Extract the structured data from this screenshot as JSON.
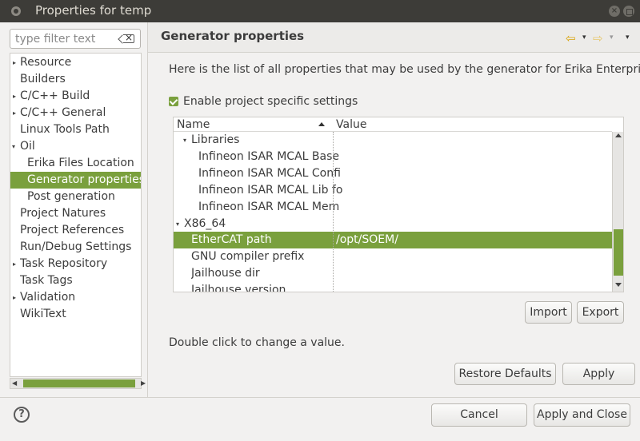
{
  "window": {
    "title": "Properties for temp",
    "close_glyph": "×"
  },
  "filter": {
    "placeholder": "type filter text"
  },
  "tree": {
    "items": [
      {
        "label": "Resource",
        "expander": "▸",
        "selected": false
      },
      {
        "label": "Builders",
        "expander": "",
        "selected": false
      },
      {
        "label": "C/C++ Build",
        "expander": "▸",
        "selected": false
      },
      {
        "label": "C/C++ General",
        "expander": "▸",
        "selected": false
      },
      {
        "label": "Linux Tools Path",
        "expander": "",
        "selected": false
      },
      {
        "label": "Oil",
        "expander": "▾",
        "selected": false
      },
      {
        "label": "Erika Files Location",
        "expander": "",
        "selected": false
      },
      {
        "label": "Generator properties",
        "expander": "",
        "selected": true
      },
      {
        "label": "Post generation",
        "expander": "",
        "selected": false
      },
      {
        "label": "Project Natures",
        "expander": "",
        "selected": false
      },
      {
        "label": "Project References",
        "expander": "",
        "selected": false
      },
      {
        "label": "Run/Debug Settings",
        "expander": "",
        "selected": false
      },
      {
        "label": "Task Repository",
        "expander": "▸",
        "selected": false
      },
      {
        "label": "Task Tags",
        "expander": "",
        "selected": false
      },
      {
        "label": "Validation",
        "expander": "▸",
        "selected": false
      },
      {
        "label": "WikiText",
        "expander": "",
        "selected": false
      }
    ]
  },
  "page": {
    "title": "Generator properties",
    "description": "Here is the list of all properties that may be used by the generator for Erika Enterprise.",
    "enable_label": "Enable project specific settings",
    "enable_checked": true,
    "hint": "Double click to change a value.",
    "nav": {
      "back": "⇦",
      "forward": "⇨",
      "dropdown": "▾"
    }
  },
  "table": {
    "headers": {
      "name": "Name",
      "value": "Value"
    },
    "rows": [
      {
        "name": "Libraries",
        "value": "",
        "expander": "▾",
        "selected": false
      },
      {
        "name": "Infineon ISAR MCAL Base",
        "value": "",
        "expander": "",
        "selected": false
      },
      {
        "name": "Infineon ISAR MCAL Confi",
        "value": "",
        "expander": "",
        "selected": false
      },
      {
        "name": "Infineon ISAR MCAL Lib fo",
        "value": "",
        "expander": "",
        "selected": false
      },
      {
        "name": "Infineon ISAR MCAL Mem",
        "value": "",
        "expander": "",
        "selected": false
      },
      {
        "name": "X86_64",
        "value": "",
        "expander": "▾",
        "selected": false
      },
      {
        "name": "EtherCAT path",
        "value": "/opt/SOEM/",
        "expander": "",
        "selected": true
      },
      {
        "name": "GNU compiler prefix",
        "value": "",
        "expander": "",
        "selected": false
      },
      {
        "name": "Jailhouse dir",
        "value": "",
        "expander": "",
        "selected": false
      },
      {
        "name": "Jailhouse version",
        "value": "",
        "expander": "",
        "selected": false
      }
    ]
  },
  "buttons": {
    "import": "Import",
    "export": "Export",
    "restore_defaults": "Restore Defaults",
    "apply": "Apply",
    "cancel": "Cancel",
    "apply_and_close": "Apply and Close",
    "help": "?"
  },
  "colors": {
    "accent": "#7aa03d",
    "titlebar": "#3d3c38"
  }
}
